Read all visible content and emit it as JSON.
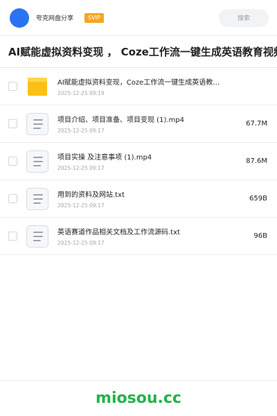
{
  "header": {
    "username": "夸克网盘分享",
    "badge": "SVIP",
    "search_label": "搜索"
  },
  "title": "AI赋能虚拟资料变现 ， Coze工作流一键生成英语教育视频",
  "files": [
    {
      "name": "AI赋能虚拟资料变现，Coze工作流一键生成英语教…",
      "date": "2025-12-25 09:19",
      "size": "",
      "type": "folder"
    },
    {
      "name": "项目介绍、项目准备、项目变现 (1).mp4",
      "date": "2025-12-25 09:17",
      "size": "67.7M",
      "type": "file"
    },
    {
      "name": "项目实操 及注意事项 (1).mp4",
      "date": "2025-12-25 09:17",
      "size": "87.6M",
      "type": "file"
    },
    {
      "name": "用到的资料及网站.txt",
      "date": "2025-12-25 09:17",
      "size": "659B",
      "type": "file"
    },
    {
      "name": "英语赛道作品相关文档及工作流源码.txt",
      "date": "2025-12-25 09:17",
      "size": "96B",
      "type": "file"
    }
  ],
  "footer": {
    "brand": "miosou.cc"
  },
  "colors": {
    "accent_blue": "#2b73f0",
    "svip": "#f5a623",
    "brand_green": "#24b24a",
    "folder": "#fbbf16"
  }
}
